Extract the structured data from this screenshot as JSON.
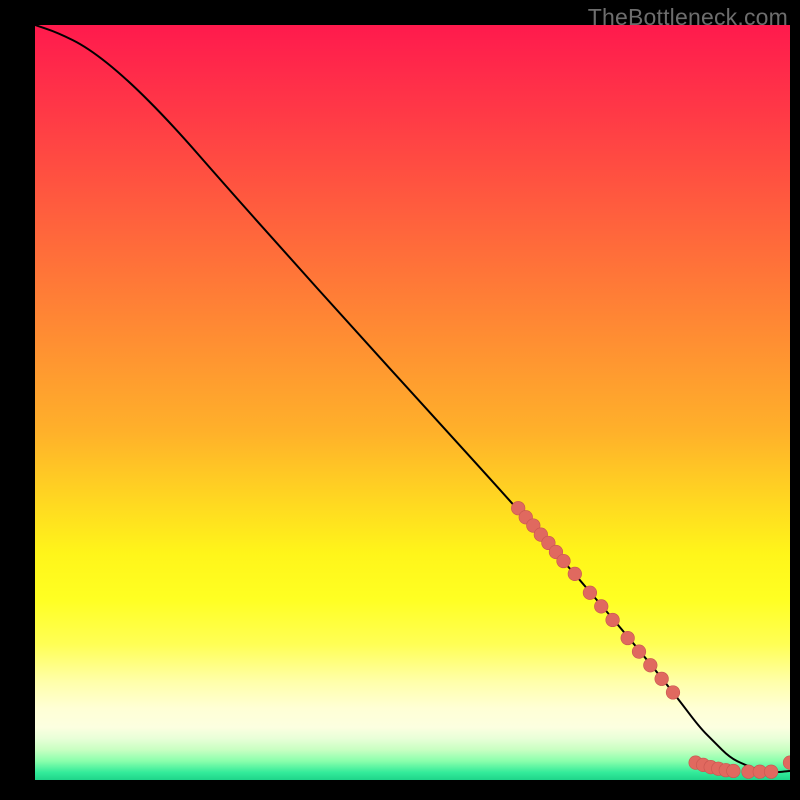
{
  "watermark": "TheBottleneck.com",
  "colors": {
    "background": "#000000",
    "curve": "#000000",
    "marker_fill": "#e0695f",
    "marker_stroke": "#c85650"
  },
  "chart_data": {
    "type": "line",
    "title": "",
    "xlabel": "",
    "ylabel": "",
    "xlim": [
      0,
      100
    ],
    "ylim": [
      0,
      100
    ],
    "series": [
      {
        "name": "curve",
        "x": [
          0,
          3,
          7,
          12,
          18,
          25,
          33,
          42,
          52,
          62,
          70,
          76,
          81,
          85,
          88,
          90,
          92,
          94,
          96,
          98,
          100
        ],
        "y": [
          100,
          99,
          97,
          93,
          87,
          79,
          70,
          60,
          49,
          38,
          29,
          22,
          16,
          11,
          7,
          5,
          3,
          2,
          1.3,
          1,
          1.2
        ]
      }
    ],
    "markers": [
      {
        "x": 64.0,
        "y": 36.0
      },
      {
        "x": 65.0,
        "y": 34.8
      },
      {
        "x": 66.0,
        "y": 33.7
      },
      {
        "x": 67.0,
        "y": 32.5
      },
      {
        "x": 68.0,
        "y": 31.4
      },
      {
        "x": 69.0,
        "y": 30.2
      },
      {
        "x": 70.0,
        "y": 29.0
      },
      {
        "x": 71.5,
        "y": 27.3
      },
      {
        "x": 73.5,
        "y": 24.8
      },
      {
        "x": 75.0,
        "y": 23.0
      },
      {
        "x": 76.5,
        "y": 21.2
      },
      {
        "x": 78.5,
        "y": 18.8
      },
      {
        "x": 80.0,
        "y": 17.0
      },
      {
        "x": 81.5,
        "y": 15.2
      },
      {
        "x": 83.0,
        "y": 13.4
      },
      {
        "x": 84.5,
        "y": 11.6
      },
      {
        "x": 87.5,
        "y": 2.3
      },
      {
        "x": 88.5,
        "y": 2.0
      },
      {
        "x": 89.5,
        "y": 1.7
      },
      {
        "x": 90.5,
        "y": 1.5
      },
      {
        "x": 91.5,
        "y": 1.3
      },
      {
        "x": 92.5,
        "y": 1.2
      },
      {
        "x": 94.5,
        "y": 1.1
      },
      {
        "x": 96.0,
        "y": 1.1
      },
      {
        "x": 97.5,
        "y": 1.1
      },
      {
        "x": 100.0,
        "y": 2.3
      }
    ],
    "marker_radius_data_units": 0.9
  }
}
